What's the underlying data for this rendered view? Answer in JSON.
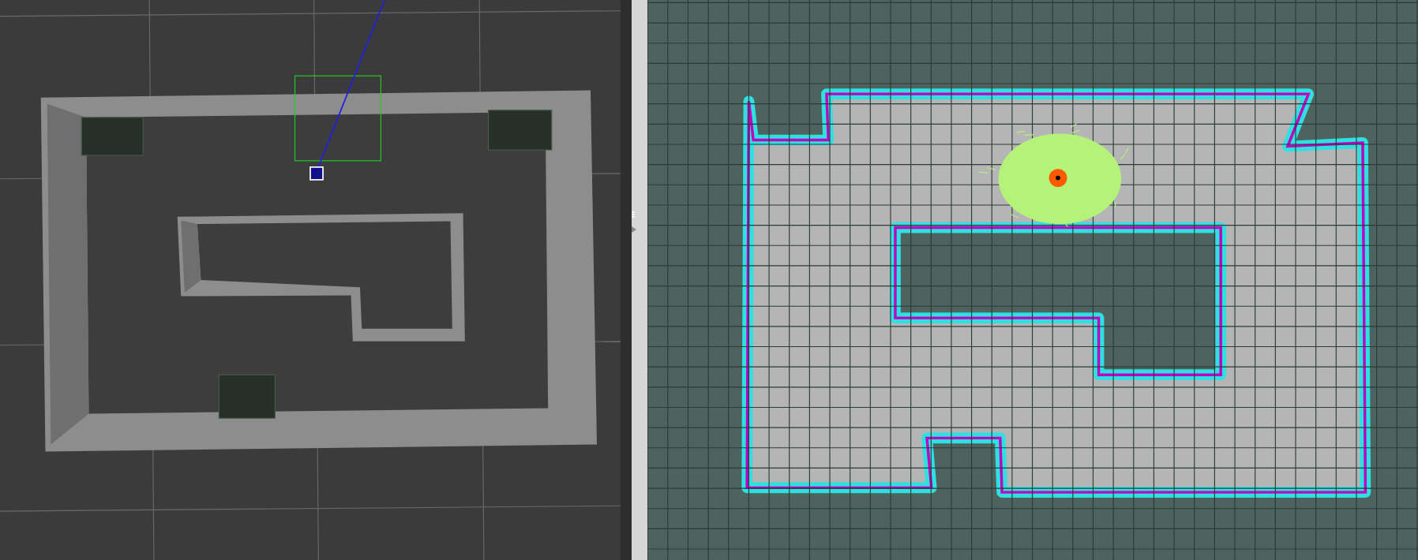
{
  "panes": [
    {
      "kind": "simulation-view"
    },
    {
      "kind": "map-view"
    }
  ]
}
